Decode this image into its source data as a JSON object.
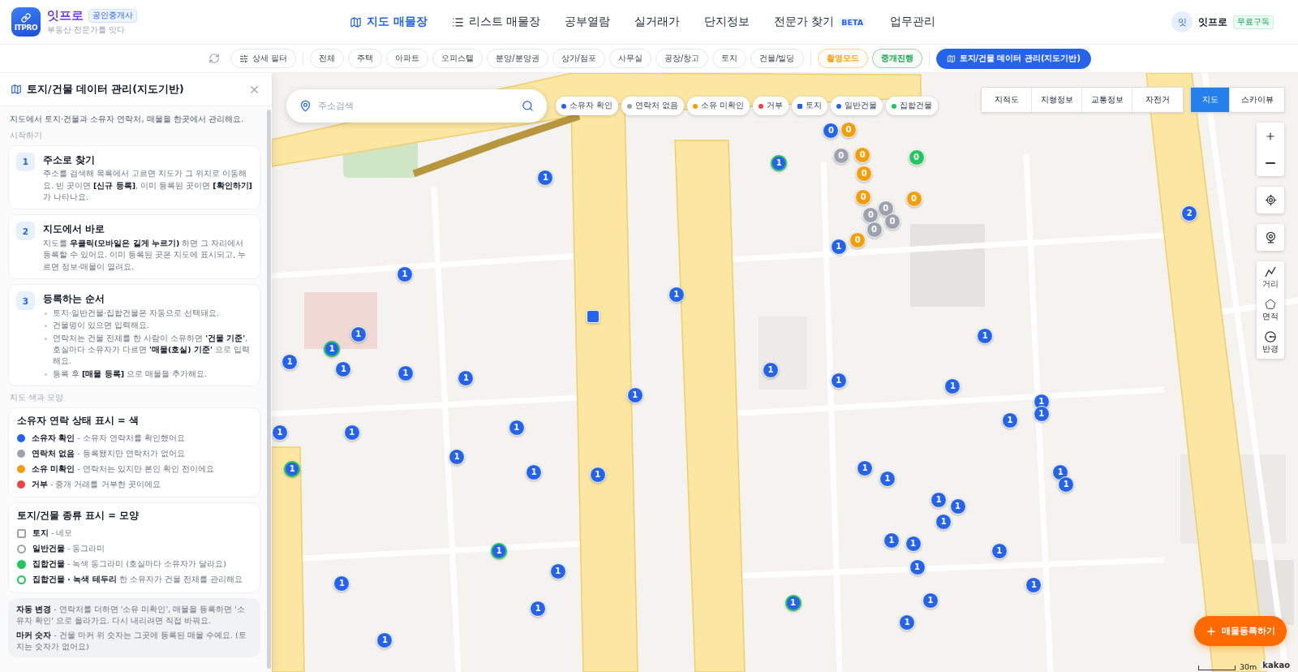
{
  "header": {
    "logo_text": "ITPRO",
    "brand": "잇프로",
    "brand_badge": "공인중개사",
    "tagline": "부동산 전문가를 잇다",
    "nav": [
      {
        "label": "지도 매물장",
        "kind": "map",
        "selected": true
      },
      {
        "label": "리스트 매물장",
        "kind": "list",
        "selected": false
      },
      {
        "label": "공부열람",
        "kind": "plain",
        "selected": false
      },
      {
        "label": "실거래가",
        "kind": "plain",
        "selected": false
      },
      {
        "label": "단지정보",
        "kind": "plain",
        "selected": false
      },
      {
        "label": "전문가 찾기",
        "kind": "plain",
        "badge": "BETA",
        "selected": false
      },
      {
        "label": "업무관리",
        "kind": "plain",
        "selected": false
      }
    ],
    "user": {
      "avatar": "잇",
      "name": "잇프로",
      "plan": "무료구독"
    }
  },
  "filter_bar": {
    "detail_filter": "상세 필터",
    "categories": [
      "전체",
      "주택",
      "아파트",
      "오피스텔",
      "분양/분양권",
      "상가/점포",
      "사무실",
      "공장/창고",
      "토지",
      "건물/빌딩"
    ],
    "modes": [
      {
        "label": "촬영모드",
        "color": "#f59e0b"
      },
      {
        "label": "중개진행",
        "color": "#16a34a"
      }
    ],
    "data_button": {
      "label": "토지/건물 데이터 관리(지도기반)",
      "active": true
    }
  },
  "side_panel": {
    "title": "토지/건물 데이터 관리(지도기반)",
    "intro": "지도에서 토지·건물과 소유자 연락처, 매물을 한곳에서 관리해요.",
    "start_label": "시작하기",
    "steps": [
      {
        "number": "1",
        "title": "주소로 찾기",
        "text": "주소를 검색해 목록에서 고르면 지도가 그 위치로 이동해요. 빈 곳이면 **[신규 등록]**, 이미 등록된 곳이면 **[확인하기]** 가 나타나요."
      },
      {
        "number": "2",
        "title": "지도에서 바로",
        "text": "지도를 **우클릭(모바일은 길게 누르기)** 하면 그 자리에서 등록할 수 있어요. 이미 등록된 곳은 지도에 표시되고, 누르면 정보·매물이 열려요."
      },
      {
        "number": "3",
        "title": "등록하는 순서",
        "bullets": [
          "토지·일반건물·집합건물은 자동으로 선택돼요.",
          "건물명이 있으면 입력해요.",
          "연락처는 건물 전체를 한 사람이 소유하면 **'건물 기준'**, 호실마다 소유자가 다르면 **'매물(호실) 기준'** 으로 입력해요.",
          "등록 후 **[매물 등록]** 으로 매물을 추가해요."
        ]
      }
    ],
    "legend_label": "지도 색과 모양",
    "status_legend": {
      "title": "소유자 연락 상태 표시 = 색",
      "items": [
        {
          "text": "**소유자 확인** - 소유자 연락처를 확인했어요",
          "color": "#2563eb"
        },
        {
          "text": "**연락처 없음** - 등록됐지만 연락처가 없어요",
          "color": "#9ca3af"
        },
        {
          "text": "**소유 미확인** - 연락처는 있지만 본인 확인 전이에요",
          "color": "#f59e0b"
        },
        {
          "text": "**거부** - 중개 거래를 거부한 곳이에요",
          "color": "#ef4444"
        }
      ]
    },
    "shape_legend": {
      "title": "토지/건물 종류 표시 = 모양",
      "items": [
        {
          "text": "**토지** - 네모",
          "kind": "square",
          "color": "#9ca3af"
        },
        {
          "text": "**일반건물** - 동그라미",
          "kind": "circle",
          "color": "#9ca3af"
        },
        {
          "text": "**집합건물** - 녹색 동그라미 (호실마다 소유자가 달라요)",
          "kind": "dot",
          "color": "#22c55e"
        },
        {
          "text": "**집합건물 · 녹색 테두리** 한 소유자가 건물 전체를 관리해요",
          "kind": "ring",
          "color": "#22c55e"
        }
      ]
    },
    "notes": [
      "**자동 변경** - 연락처를 더하면 '소유 미확인', 매물을 등록하면 '소유자 확인' 으로 올라가요. 다시 내리려면 직접 바꿔요.",
      "**마커 숫자** - 건물 마커 위 숫자는 그곳에 등록된 매물 수예요. (토지는 숫자가 없어요)"
    ]
  },
  "map": {
    "search": {
      "placeholder": "주소검색"
    },
    "legend": [
      {
        "label": "소유자 확인",
        "kind": "dot",
        "color": "#2563eb"
      },
      {
        "label": "연락처 없음",
        "kind": "dot",
        "color": "#9ca3af"
      },
      {
        "label": "소유 미확인",
        "kind": "dot",
        "color": "#f59e0b"
      },
      {
        "label": "거부",
        "kind": "dot",
        "color": "#ef4444"
      },
      {
        "label": "토지",
        "kind": "square",
        "color": "#2563eb"
      },
      {
        "label": "일반건물",
        "kind": "dot",
        "color": "#2563eb"
      },
      {
        "label": "집합건물",
        "kind": "dot",
        "color": "#22c55e"
      }
    ],
    "overlay_types": [
      {
        "label": "지적도",
        "selected": false
      },
      {
        "label": "지형정보",
        "selected": false
      },
      {
        "label": "교통정보",
        "selected": false
      },
      {
        "label": "자전거",
        "selected": false
      }
    ],
    "map_types": [
      {
        "label": "지도",
        "selected": true
      },
      {
        "label": "스카이뷰",
        "selected": false
      }
    ],
    "tools": [
      {
        "label": "거리",
        "kind": "distance"
      },
      {
        "label": "면적",
        "kind": "area"
      },
      {
        "label": "반경",
        "kind": "radius"
      }
    ],
    "register_button": "매물등록하기",
    "scale": "30m",
    "attribution": "kakao",
    "markers": [
      {
        "count": "1",
        "color": "#2563eb",
        "kind": "circle"
      },
      {
        "count": "1",
        "color": "#2563eb",
        "kind": "ring"
      },
      {
        "count": "0",
        "color": "#2563eb",
        "kind": "circle"
      },
      {
        "count": "0",
        "color": "#f59e0b",
        "kind": "circle"
      },
      {
        "count": "0",
        "color": "#9ca3af",
        "kind": "circle"
      },
      {
        "count": "0",
        "color": "#f59e0b",
        "kind": "circle"
      },
      {
        "count": "0",
        "color": "#22c55e",
        "kind": "circle"
      },
      {
        "count": "0",
        "color": "#f59e0b",
        "kind": "circle"
      },
      {
        "count": "0",
        "color": "#f59e0b",
        "kind": "circle"
      },
      {
        "count": "0",
        "color": "#f59e0b",
        "kind": "circle"
      },
      {
        "count": "0",
        "color": "#9ca3af",
        "kind": "circle"
      },
      {
        "count": "0",
        "color": "#9ca3af",
        "kind": "circle"
      },
      {
        "count": "0",
        "color": "#9ca3af",
        "kind": "circle"
      },
      {
        "count": "0",
        "color": "#9ca3af",
        "kind": "circle"
      },
      {
        "count": "0",
        "color": "#f59e0b",
        "kind": "circle"
      },
      {
        "count": "1",
        "color": "#2563eb",
        "kind": "circle"
      },
      {
        "count": "1",
        "color": "#2563eb",
        "kind": "circle"
      },
      {
        "count": "1",
        "color": "#2563eb",
        "kind": "circle"
      },
      {
        "color": "#2563eb",
        "kind": "square"
      },
      {
        "count": "1",
        "color": "#2563eb",
        "kind": "circle"
      },
      {
        "count": "1",
        "color": "#2563eb",
        "kind": "ring"
      },
      {
        "count": "1",
        "color": "#2563eb",
        "kind": "circle"
      },
      {
        "count": "1",
        "color": "#2563eb",
        "kind": "circle"
      },
      {
        "count": "1",
        "color": "#2563eb",
        "kind": "circle"
      },
      {
        "count": "1",
        "color": "#2563eb",
        "kind": "circle"
      },
      {
        "count": "1",
        "color": "#2563eb",
        "kind": "circle"
      },
      {
        "count": "1",
        "color": "#2563eb",
        "kind": "circle"
      },
      {
        "count": "1",
        "color": "#2563eb",
        "kind": "circle"
      },
      {
        "count": "1",
        "color": "#2563eb",
        "kind": "circle"
      },
      {
        "count": "1",
        "color": "#2563eb",
        "kind": "circle"
      },
      {
        "count": "1",
        "color": "#2563eb",
        "kind": "circle"
      },
      {
        "count": "1",
        "color": "#2563eb",
        "kind": "circle"
      },
      {
        "count": "1",
        "color": "#2563eb",
        "kind": "circle"
      },
      {
        "count": "1",
        "color": "#2563eb",
        "kind": "circle"
      },
      {
        "count": "1",
        "color": "#2563eb",
        "kind": "circle"
      },
      {
        "count": "1",
        "color": "#2563eb",
        "kind": "circle"
      },
      {
        "count": "1",
        "color": "#2563eb",
        "kind": "circle"
      },
      {
        "count": "1",
        "color": "#2563eb",
        "kind": "ring"
      },
      {
        "count": "1",
        "color": "#2563eb",
        "kind": "circle"
      },
      {
        "count": "1",
        "color": "#2563eb",
        "kind": "circle"
      },
      {
        "count": "1",
        "color": "#2563eb",
        "kind": "circle"
      },
      {
        "count": "1",
        "color": "#2563eb",
        "kind": "circle"
      },
      {
        "count": "1",
        "color": "#2563eb",
        "kind": "circle"
      },
      {
        "count": "1",
        "color": "#2563eb",
        "kind": "circle"
      },
      {
        "count": "1",
        "color": "#2563eb",
        "kind": "circle"
      },
      {
        "count": "1",
        "color": "#2563eb",
        "kind": "circle"
      },
      {
        "count": "1",
        "color": "#2563eb",
        "kind": "circle"
      },
      {
        "count": "1",
        "color": "#2563eb",
        "kind": "circle"
      },
      {
        "count": "1",
        "color": "#2563eb",
        "kind": "circle"
      },
      {
        "count": "1",
        "color": "#2563eb",
        "kind": "circle"
      },
      {
        "count": "1",
        "color": "#2563eb",
        "kind": "circle"
      },
      {
        "count": "1",
        "color": "#2563eb",
        "kind": "circle"
      },
      {
        "count": "1",
        "color": "#2563eb",
        "kind": "ring"
      },
      {
        "count": "1",
        "color": "#2563eb",
        "kind": "circle"
      },
      {
        "count": "1",
        "color": "#2563eb",
        "kind": "circle"
      },
      {
        "count": "1",
        "color": "#2563eb",
        "kind": "circle"
      },
      {
        "count": "1",
        "color": "#2563eb",
        "kind": "ring"
      },
      {
        "count": "1",
        "color": "#2563eb",
        "kind": "circle"
      },
      {
        "count": "1",
        "color": "#2563eb",
        "kind": "circle"
      },
      {
        "count": "1",
        "color": "#2563eb",
        "kind": "circle"
      },
      {
        "count": "2",
        "color": "#2563eb",
        "kind": "circle"
      }
    ]
  }
}
